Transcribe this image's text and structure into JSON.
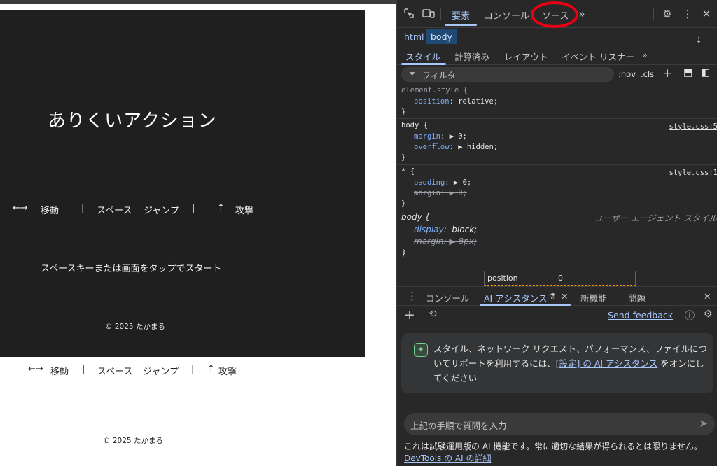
{
  "page": {
    "game": {
      "title": "ありくいアクション",
      "controls": {
        "move_arrows": "←→",
        "move": "移動",
        "sep": "|",
        "space": "スペース",
        "jump": "ジャンプ",
        "attack_arrow": "↑",
        "attack": "攻撃"
      },
      "start_message": "スペースキーまたは画面をタップでスタート",
      "copyright": "© 2025 たかまる"
    },
    "below": {
      "controls": {
        "move_arrows": "←→",
        "move": "移動",
        "sep": "|",
        "space": "スペース",
        "jump": "ジャンプ",
        "attack_arrow": "↑",
        "attack": "攻撃"
      },
      "copyright": "© 2025 たかまる"
    }
  },
  "devtools": {
    "tabs": [
      "要素",
      "コンソール",
      "ソース"
    ],
    "active_tab": "要素",
    "highlighted_tab": "ソース",
    "breadcrumbs": [
      "html",
      "body"
    ],
    "subtabs": [
      "スタイル",
      "計算済み",
      "レイアウト",
      "イベント リスナー"
    ],
    "active_subtab": "スタイル",
    "filter_placeholder": "フィルタ",
    "filter_tools": {
      "hov": ":hov",
      "cls": ".cls",
      "add": "+"
    },
    "rules": {
      "r1": {
        "selector": "element.style {",
        "p1": "position",
        "v1": "relative;",
        "close": "}"
      },
      "r2": {
        "selector": "body {",
        "source": "style.css:5",
        "p1": "margin",
        "v1": "0;",
        "p2": "overflow",
        "v2": "hidden;",
        "close": "}"
      },
      "r3": {
        "selector": "* {",
        "source": "style.css:1",
        "p1": "padding",
        "v1": "0;",
        "p2": "margin",
        "v2": "0;",
        "close": "}"
      },
      "r4": {
        "selector": "body {",
        "source": "ユーザー エージェント スタイルシート",
        "p1": "display",
        "v1": "block;",
        "p2": "margin",
        "v2": "8px;",
        "close": "}"
      }
    },
    "boxmodel": {
      "label": "position",
      "value": "0"
    },
    "drawer_tabs": [
      "コンソール",
      "AI アシスタンス",
      "新機能",
      "問題"
    ],
    "active_drawer_tab": "AI アシスタンス",
    "ai": {
      "send_feedback": "Send feedback",
      "card_text_1": "スタイル、ネットワーク リクエスト、パフォーマンス、ファイルについてサポートを利用するには、",
      "card_link": "[設定] の AI アシスタンス",
      "card_text_2": " をオンにしてください",
      "input_placeholder": "上記の手順で質問を入力",
      "footer_text": "これは試験運用版の AI 機能です。常に適切な結果が得られるとは限りません。",
      "footer_link": "DevTools の AI の詳細"
    }
  },
  "colors": {
    "game_bg": "#1f1f1f",
    "devtools_bg": "#282828",
    "accent": "#a8c7fa",
    "annotation": "#e60012"
  }
}
